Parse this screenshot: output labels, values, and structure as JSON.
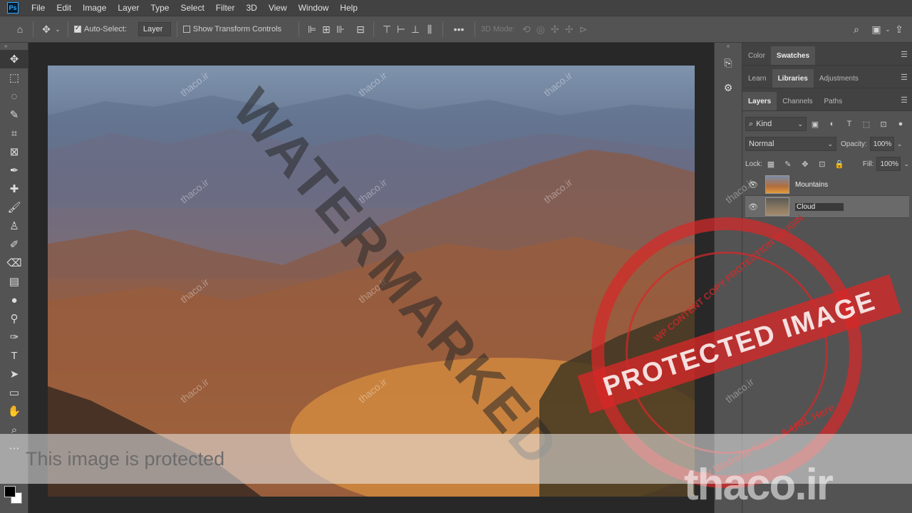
{
  "menubar": {
    "logo": "Ps",
    "items": [
      "File",
      "Edit",
      "Image",
      "Layer",
      "Type",
      "Select",
      "Filter",
      "3D",
      "View",
      "Window",
      "Help"
    ]
  },
  "options": {
    "auto_select_label": "Auto-Select:",
    "auto_select_value": "Layer",
    "show_transform_label": "Show Transform Controls",
    "mode_3d_label": "3D Mode:",
    "more_label": "•••"
  },
  "panels": {
    "top_tabs": [
      "Color",
      "Swatches"
    ],
    "top_active": "Swatches",
    "mid_tabs": [
      "Learn",
      "Libraries",
      "Adjustments"
    ],
    "mid_active": "Libraries",
    "layer_tabs": [
      "Layers",
      "Channels",
      "Paths"
    ],
    "layer_active": "Layers",
    "filter_kind": "Kind",
    "blend_mode": "Normal",
    "opacity_label": "Opacity:",
    "opacity_value": "100%",
    "lock_label": "Lock:",
    "fill_label": "Fill:",
    "fill_value": "100%",
    "layers": [
      {
        "name": "Mountains",
        "visible": true,
        "selected": false
      },
      {
        "name": "Cloud",
        "visible": true,
        "selected": true
      }
    ]
  },
  "overlay": {
    "banner": "This image is protected",
    "diagonal": "WATERMARKED",
    "stamp_center": "PROTECTED IMAGE",
    "stamp_top": "WP CONTENT COPY PROTECTION PLUGIN",
    "stamp_bottom": "My Website Name & URL Here",
    "tile_text": "thaco.ir",
    "logo": "thaco.ir"
  },
  "colors": {
    "accent": "#31a8ff",
    "stamp_red": "#d72828",
    "panel_bg": "#535353"
  }
}
